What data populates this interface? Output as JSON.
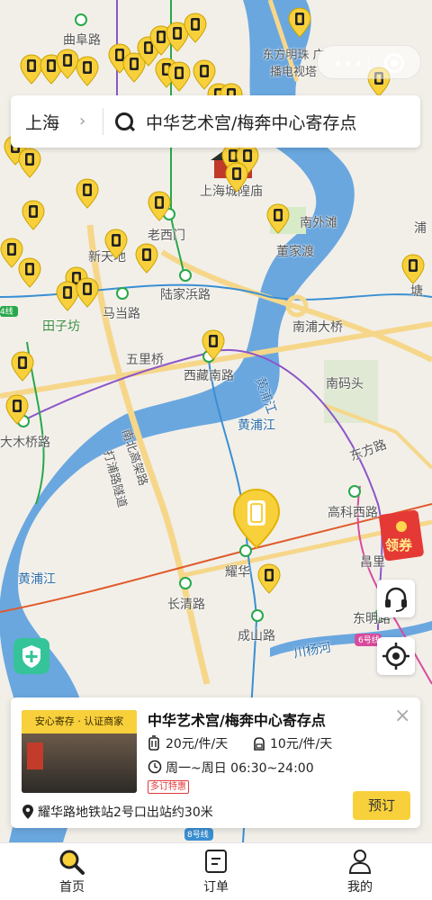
{
  "map": {
    "labels": {
      "qufu_road": "曲阜路",
      "oriental_pearl": "东方明珠\n广播电视塔",
      "chenghuang": "上海城隍庙",
      "nanwaitan": "南外滩",
      "laoximen": "老西门",
      "xintiandi": "新天地",
      "dongjiadu": "董家渡",
      "lujiabang": "陆家浜路",
      "madang": "马当路",
      "tianzifang": "田子坊",
      "nanpu_bridge": "南浦大桥",
      "wulixiao": "五里桥",
      "xizang_south": "西藏南路",
      "nanmatou": "南码头",
      "huangpu_river_1": "黄浦江",
      "huangpu_river_2": "黄浦江",
      "huangpu_river_3": "黄浦江",
      "dongfang_road": "东方路",
      "dashuqiao": "大木桥路",
      "north_south_elevated": "南北高架路",
      "dapu_tunnel": "打浦路隧道",
      "gaoke_west": "高科西路",
      "changqing": "长清路",
      "yaohua": "耀华",
      "chengshan": "成山路",
      "dongming": "东明路",
      "chuanyang_river": "川杨河",
      "changli": "昌里",
      "pu": "浦",
      "tang": "塘",
      "line_8": "8号线",
      "line_6": "6号线",
      "line_4": "4线"
    },
    "coupon_text": "领券"
  },
  "search": {
    "city": "上海",
    "query": "中华艺术宫/梅奔中心寄存点"
  },
  "card": {
    "badge": "安心寄存 · 认证商家",
    "title": "中华艺术宫/梅奔中心寄存点",
    "price_large": "20元/件/天",
    "price_small": "10元/件/天",
    "hours": "周一~周日 06:30~24:00",
    "promo": "多订特惠",
    "address": "耀华路地铁站2号口出站约30米",
    "book_label": "预订"
  },
  "tabs": [
    {
      "label": "首页",
      "icon": "search-icon",
      "active": true
    },
    {
      "label": "订单",
      "icon": "order-icon",
      "active": false
    },
    {
      "label": "我的",
      "icon": "profile-icon",
      "active": false
    }
  ],
  "colors": {
    "accent": "#f7d03c",
    "water": "#5b9bd5",
    "metro_green": "#27a84a",
    "metro_blue": "#3a8fd3"
  }
}
